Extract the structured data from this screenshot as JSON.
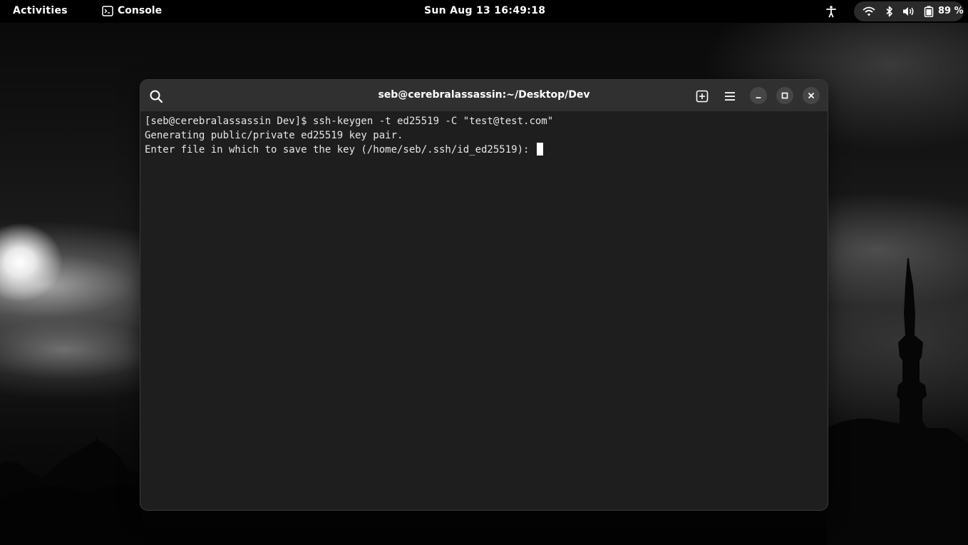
{
  "topbar": {
    "activities_label": "Activities",
    "app_name": "Console",
    "clock": "Sun Aug 13  16:49:18",
    "battery_percent": "89 %",
    "icons": [
      "accessibility-icon",
      "wifi-icon",
      "bluetooth-icon",
      "volume-icon",
      "battery-icon"
    ]
  },
  "window": {
    "title": "seb@cerebralassassin:~/Desktop/Dev",
    "buttons": [
      "search-icon",
      "new-tab-icon",
      "hamburger-menu-icon",
      "minimize-icon",
      "maximize-icon",
      "close-icon"
    ]
  },
  "terminal": {
    "lines": [
      "[seb@cerebralassassin Dev]$ ssh-keygen -t ed25519 -C \"test@test.com\"",
      "Generating public/private ed25519 key pair.",
      "Enter file in which to save the key (/home/seb/.ssh/id_ed25519): "
    ]
  },
  "colors": {
    "topbar_bg": "#000000",
    "window_bg": "#1e1e1e",
    "titlebar_bg": "#303030",
    "text": "#e6e6e6"
  }
}
